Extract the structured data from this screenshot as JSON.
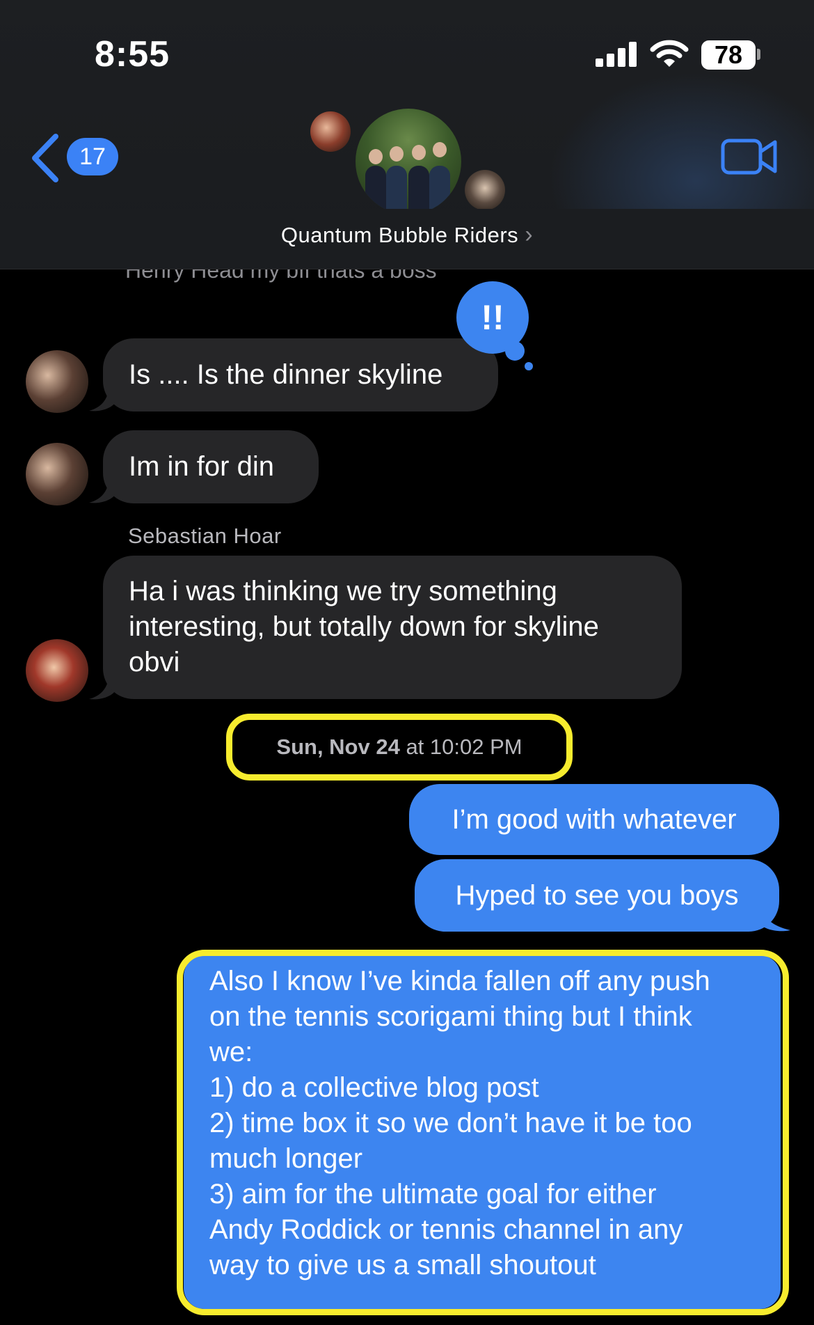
{
  "status_bar": {
    "time": "8:55",
    "battery": "78"
  },
  "header": {
    "back_count": "17",
    "group_name": "Quantum Bubble Riders",
    "group_chevron": "›"
  },
  "messages": {
    "cropped_previous": "Henry Head my bff thats a boss",
    "tapback": "!!",
    "m1": "Is .... Is the dinner skyline",
    "m2": "Im in for din",
    "sender3": "Sebastian Hoar",
    "m3_line1": "Ha i was thinking we try something",
    "m3_line2": "interesting, but totally down for skyline",
    "m3_line3": "obvi",
    "timestamp_day": "Sun, Nov 24",
    "timestamp_time": " at 10:02 PM",
    "out1": "I’m good with whatever",
    "out2": "Hyped to see you boys",
    "out3_lines": [
      "Also I know I’ve kinda fallen off any push",
      "on the tennis scorigami thing but I think",
      "we:",
      "1) do a collective blog post",
      "2) time box it so we don’t have it be too",
      "much longer",
      "3) aim for the ultimate goal for either",
      "Andy Roddick or tennis channel in any",
      "way to give us a small shoutout"
    ]
  },
  "colors": {
    "accent_blue": "#3d85f0",
    "incoming_bubble": "#262628",
    "highlight_yellow": "#f7ec2e"
  },
  "icons": [
    "signal-icon",
    "wifi-icon",
    "battery-icon",
    "back-chevron-icon",
    "video-camera-icon",
    "chevron-right-icon"
  ]
}
